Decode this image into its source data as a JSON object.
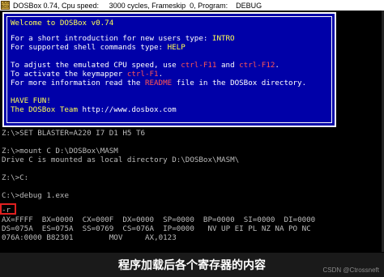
{
  "window": {
    "icon_label_top": "DOS",
    "icon_label_bottom": "BOX",
    "title": "DOSBox 0.74, Cpu speed:     3000 cycles, Frameskip  0, Program:    DEBUG"
  },
  "banner": {
    "welcome": "Welcome to DOSBox v0.74",
    "intro_a": "For a short introduction for new users type: ",
    "intro_b": "INTRO",
    "help_a": "For supported shell commands type: ",
    "help_b": "HELP",
    "cpu_a": "To adjust the emulated CPU speed, use ",
    "cpu_b": "ctrl-F11",
    "cpu_c": " and ",
    "cpu_d": "ctrl-F12",
    "cpu_e": ".",
    "key_a": "To activate the keymapper ",
    "key_b": "ctrl-F1",
    "key_c": ".",
    "more_a": "For more information read the ",
    "more_b": "README",
    "more_c": " file in the DOSBox directory.",
    "fun": "HAVE FUN!",
    "team_a": "The DOSBox Team ",
    "team_b": "http://www.dosbox.com"
  },
  "console": [
    "Z:\\>SET BLASTER=A220 I7 D1 H5 T6",
    "",
    "Z:\\>mount C D:\\DOSBox\\MASM",
    "Drive C is mounted as local directory D:\\DOSBox\\MASM\\",
    "",
    "Z:\\>C:",
    "",
    "C:\\>debug 1.exe",
    "-r",
    "AX=FFFF  BX=0000  CX=000F  DX=0000  SP=0000  BP=0000  SI=0000  DI=0000",
    "DS=075A  ES=075A  SS=0769  CS=076A  IP=0000   NV UP EI PL NZ NA PO NC",
    "076A:0000 B82301        MOV     AX,0123"
  ],
  "caption": "程序加载后各个寄存器的内容",
  "watermark": "CSDN @Ctrossneft",
  "colors": {
    "banner_bg": "#0000a8",
    "highlight": "#ffff55",
    "keys": "#ff5555",
    "box": "#e02020"
  }
}
